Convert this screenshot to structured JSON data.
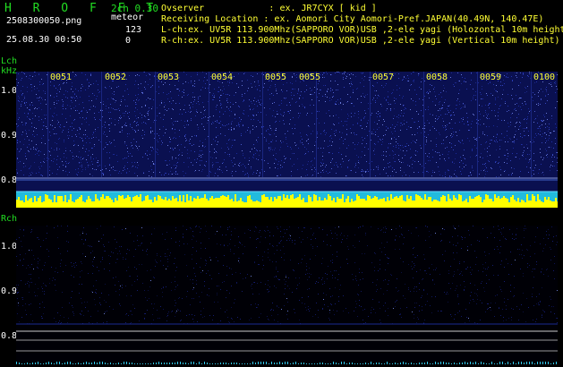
{
  "header": {
    "app_title": "H R O F F T",
    "version": "2ch 0.30",
    "file_name": "2508300050.png",
    "mode": "meteor",
    "count_lch": "123",
    "count_rch": "0",
    "timestamp": "25.08.30 00:50",
    "observer": "Ovserver            : ex. JR7CYX [ kid ]",
    "location": "Receiving Location : ex. Aomori City Aomori-Pref.JAPAN(40.49N, 140.47E)",
    "lch_info": "L-ch:ex. UV5R 113.900Mhz(SAPPORO VOR)USB ,2-ele yagi (Holozontal 10m height)",
    "rch_info": "R-ch:ex. UV5R 113.900Mhz(SAPPORO VOR)USB ,2-ele yagi (Vertical 10m height)"
  },
  "lch": {
    "label": "Lch",
    "unit": "kHz",
    "yticks": [
      "1.0",
      "0.9",
      "0.8"
    ],
    "time_labels": [
      "0051",
      "0052",
      "0053",
      "0054",
      "0055",
      "0055",
      "0057",
      "0058",
      "0059",
      "0100"
    ]
  },
  "rch": {
    "label": "Rch",
    "yticks": [
      "1.0",
      "0.9",
      "0.8"
    ]
  },
  "colors": {
    "background": "#000000",
    "text_green": "#22dd22",
    "text_yellow": "#ffff33",
    "spectrogram_blue": "#1a2a8a",
    "signal_cyan": "#33ccee",
    "signal_yellow": "#ffff00"
  }
}
